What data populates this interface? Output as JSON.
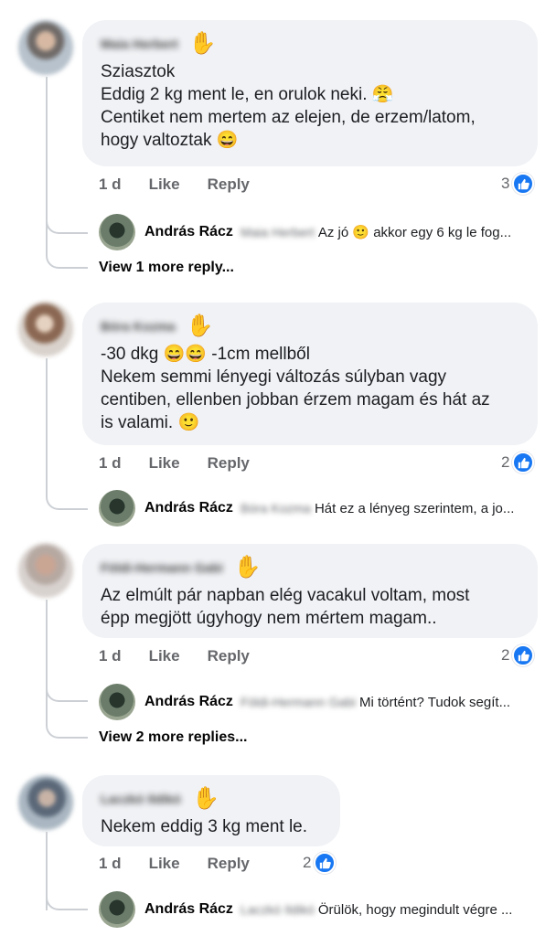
{
  "comments": [
    {
      "author_blurred": "Maia Herbert",
      "text": "Sziasztok\nEddig 2 kg ment le, en orulok neki. 😤\nCentiket nem mertem az elejen, de erzem/latom,\nhogy valtoztak 😄",
      "time": "1 d",
      "like_label": "Like",
      "reply_label": "Reply",
      "reaction_count": "3",
      "reply": {
        "author": "András Rácz",
        "tag_blurred": "Maia Herbert",
        "text": "Az jó 🙂 akkor egy 6 kg le fog..."
      },
      "more_replies": "View 1 more reply..."
    },
    {
      "author_blurred": "Bóra Kozma",
      "text": "-30 dkg 😄😄 -1cm mellből\nNekem semmi lényegi változás súlyban vagy\ncentiben, ellenben jobban érzem magam és hát az\nis valami. 🙂",
      "time": "1 d",
      "like_label": "Like",
      "reply_label": "Reply",
      "reaction_count": "2",
      "reply": {
        "author": "András Rácz",
        "tag_blurred": "Bóra Kozma",
        "text": "Hát ez a lényeg szerintem, a jo..."
      }
    },
    {
      "author_blurred": "Földi-Hermann Gabi",
      "text": "Az elmúlt pár napban elég vacakul voltam, most\népp megjött úgyhogy nem mértem magam..",
      "time": "1 d",
      "like_label": "Like",
      "reply_label": "Reply",
      "reaction_count": "2",
      "reply": {
        "author": "András Rácz",
        "tag_blurred": "Földi-Hermann Gabi",
        "text": "Mi történt? Tudok segít..."
      },
      "more_replies": "View 2 more replies..."
    },
    {
      "author_blurred": "Laczkó Ildikó",
      "text": "Nekem eddig 3 kg ment le.",
      "time": "1 d",
      "like_label": "Like",
      "reply_label": "Reply",
      "reaction_count": "2",
      "reply": {
        "author": "András Rácz",
        "tag_blurred": "Laczkó Ildikó",
        "text": "Örülök, hogy megindult végre ..."
      }
    }
  ],
  "icons": {
    "wave": "waving-hand-icon",
    "like": "thumbs-up-icon"
  },
  "colors": {
    "bubble": "#f0f2f5",
    "like_blue": "#1877f2",
    "meta_gray": "#65676b"
  }
}
